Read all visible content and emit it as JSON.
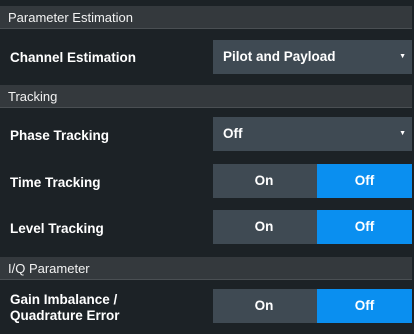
{
  "sections": {
    "parameter_estimation": "Parameter Estimation",
    "tracking": "Tracking",
    "iq_parameter": "I/Q Parameter"
  },
  "channel_estimation": {
    "label": "Channel Estimation",
    "value": "Pilot and Payload"
  },
  "phase_tracking": {
    "label": "Phase Tracking",
    "value": "Off"
  },
  "time_tracking": {
    "label": "Time Tracking",
    "on": "On",
    "off": "Off",
    "selected": "Off"
  },
  "level_tracking": {
    "label": "Level Tracking",
    "on": "On",
    "off": "Off",
    "selected": "Off"
  },
  "gain_imbalance": {
    "label_line1": "Gain Imbalance /",
    "label_line2": "Quadrature Error",
    "on": "On",
    "off": "Off",
    "selected": "Off"
  },
  "colors": {
    "panel_bg": "#1c2226",
    "header_bg": "#34393d",
    "control_bg": "#3f4a53",
    "selected_accent": "#0a8ff0"
  },
  "icons": {
    "dropdown_caret": "triangle-down"
  }
}
